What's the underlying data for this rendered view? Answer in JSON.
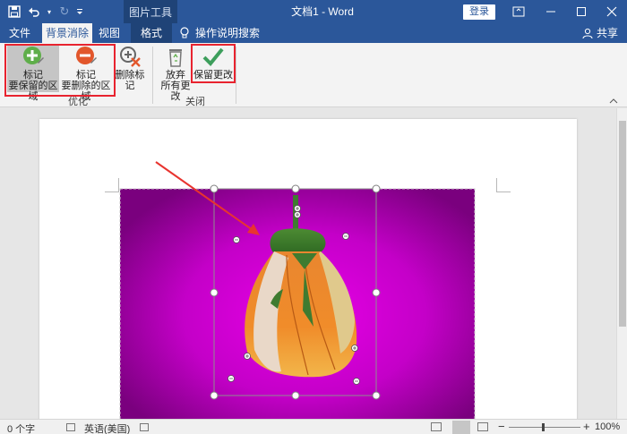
{
  "titlebar": {
    "context_title": "图片工具",
    "doc_title": "文档1 - Word",
    "login": "登录"
  },
  "tabs": {
    "file": "文件",
    "background_removal": "背景消除",
    "view": "视图",
    "format": "格式",
    "tell_me": "操作说明搜索",
    "share": "共享"
  },
  "ribbon": {
    "mark_keep": "标记\n要保留的区域",
    "mark_keep_line1": "标记",
    "mark_keep_line2": "要保留的区域",
    "mark_remove_line1": "标记",
    "mark_remove_line2": "要删除的区域",
    "delete_mark": "删除标记",
    "discard_line1": "放弃",
    "discard_line2": "所有更改",
    "keep_changes": "保留更改",
    "group_optimize": "优化",
    "group_close": "关闭"
  },
  "statusbar": {
    "word_count": "0 个字",
    "language": "英语(美国)",
    "zoom": "100%"
  },
  "colors": {
    "title_blue": "#2b579a",
    "annotation_red": "#e8232f",
    "image_magenta": "#c800c8"
  }
}
